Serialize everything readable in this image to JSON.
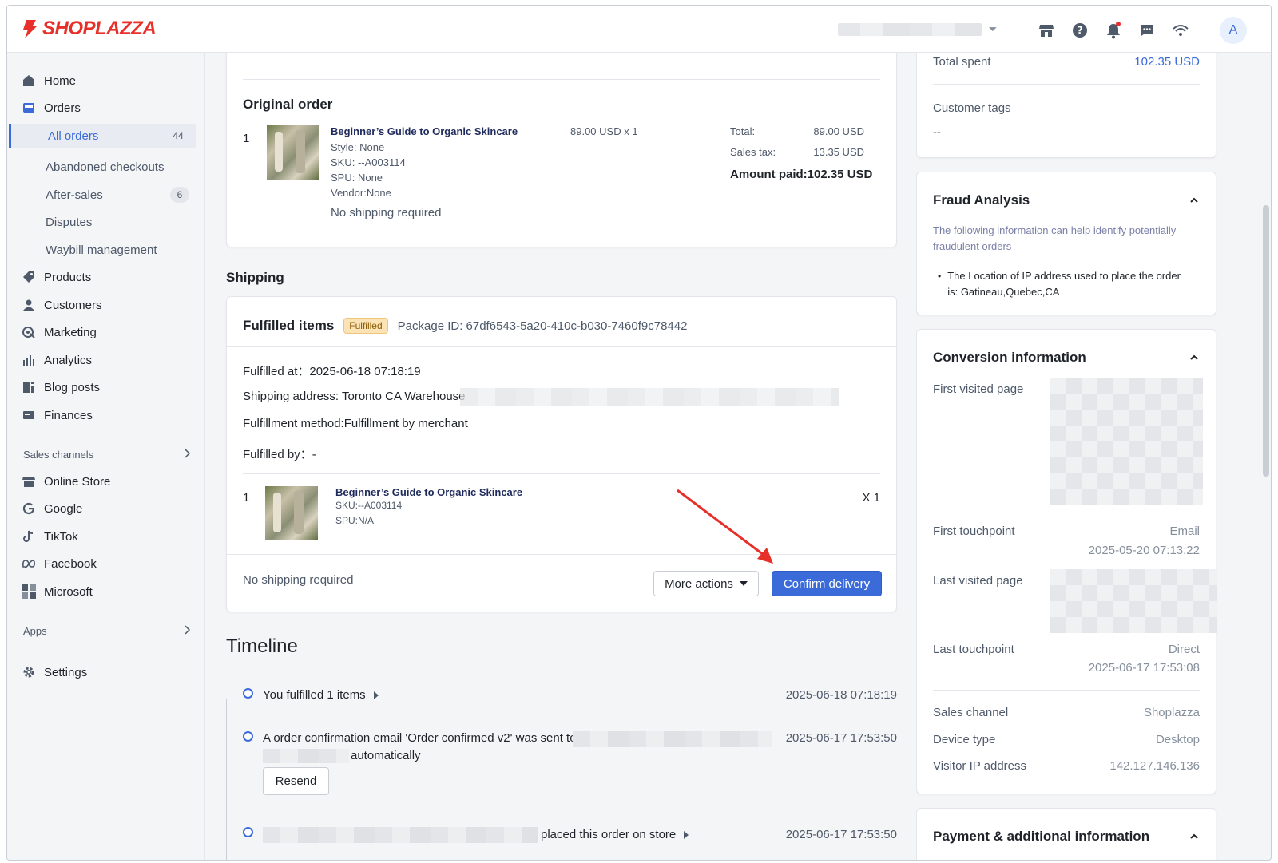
{
  "brand": {
    "logo_text": "SHOPLAZZA",
    "accent": "#e8302a",
    "primary": "#3a6bd9"
  },
  "topbar": {
    "avatar_letter": "A",
    "icons": [
      "store-icon",
      "help-icon",
      "bell-icon",
      "chat-icon",
      "wifi-icon"
    ]
  },
  "sidebar": {
    "home": "Home",
    "orders": "Orders",
    "all_orders": "All orders",
    "all_orders_count": "44",
    "abandoned": "Abandoned checkouts",
    "after_sales": "After-sales",
    "after_sales_count": "6",
    "disputes": "Disputes",
    "waybill": "Waybill management",
    "products": "Products",
    "customers": "Customers",
    "marketing": "Marketing",
    "analytics": "Analytics",
    "blog": "Blog posts",
    "finances": "Finances",
    "sales_channels": "Sales channels",
    "online_store": "Online Store",
    "google": "Google",
    "tiktok": "TikTok",
    "facebook": "Facebook",
    "microsoft": "Microsoft",
    "apps": "Apps",
    "settings": "Settings"
  },
  "original_order": {
    "title": "Original order",
    "index": "1",
    "product_name": "Beginner’s Guide to Organic Skincare",
    "style": "Style: None",
    "sku": "SKU: --A003114",
    "spu": "SPU: None",
    "vendor": "Vendor:None",
    "price_qty": "89.00 USD x 1",
    "total_label": "Total:",
    "total_value": "89.00 USD",
    "tax_label": "Sales tax:",
    "tax_value": "13.35 USD",
    "amount_paid": "Amount paid:102.35 USD",
    "shipping_note": "No shipping required"
  },
  "shipping": {
    "heading": "Shipping",
    "card_title": "Fulfilled items",
    "badge": "Fulfilled",
    "package_id": "Package ID: 67df6543-5a20-410c-b030-7460f9c78442",
    "fulfilled_at": "Fulfilled at：2025-06-18 07:18:19",
    "address": "Shipping address: Toronto CA Warehouse",
    "method": "Fulfillment method:Fulfillment by merchant",
    "fulfilled_by": "Fulfilled by：-",
    "item_index": "1",
    "item_name": "Beginner’s Guide to Organic Skincare",
    "item_sku": "SKU:--A003114",
    "item_spu": "SPU:N/A",
    "item_qty": "X 1",
    "footer_note": "No shipping required",
    "more_actions": "More actions",
    "confirm_delivery": "Confirm delivery"
  },
  "timeline": {
    "heading": "Timeline",
    "events": [
      {
        "text": "You fulfilled 1 items",
        "time": "2025-06-18 07:18:19"
      },
      {
        "text": "A order confirmation email 'Order confirmed v2' was sent to",
        "text2": "automatically",
        "time": "2025-06-17 17:53:50",
        "button": "Resend"
      },
      {
        "text": "placed this order on store",
        "time": "2025-06-17 17:53:50"
      }
    ]
  },
  "customer": {
    "total_spent_label": "Total spent",
    "total_spent_value": "102.35 USD",
    "tags_label": "Customer tags",
    "tags_value": "--"
  },
  "fraud": {
    "title": "Fraud Analysis",
    "desc": "The following information can help identify potentially fraudulent orders",
    "bullet": "The Location of IP address used to place the order is: Gatineau,Quebec,CA"
  },
  "conversion": {
    "title": "Conversion information",
    "first_visited": "First visited page",
    "first_touchpoint": "First touchpoint",
    "first_touchpoint_value": "Email",
    "first_touchpoint_time": "2025-05-20 07:13:22",
    "last_visited": "Last visited page",
    "last_touchpoint": "Last touchpoint",
    "last_touchpoint_value": "Direct",
    "last_touchpoint_time": "2025-06-17 17:53:08",
    "sales_channel": "Sales channel",
    "sales_channel_value": "Shoplazza",
    "device_type": "Device type",
    "device_type_value": "Desktop",
    "visitor_ip": "Visitor IP address",
    "visitor_ip_value": "142.127.146.136"
  },
  "payment": {
    "title": "Payment & additional information"
  }
}
